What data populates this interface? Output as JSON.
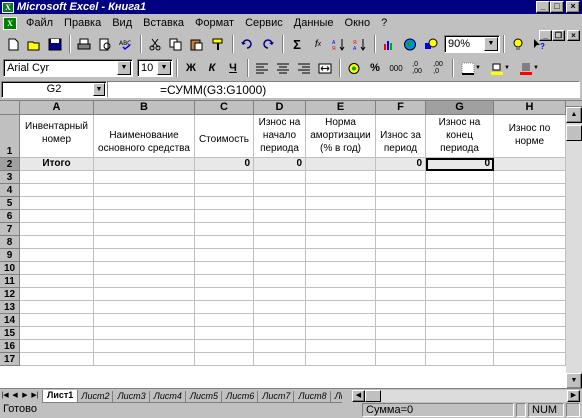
{
  "window": {
    "title": "Microsoft Excel - Книга1",
    "app_icon": "excel-icon"
  },
  "menu": [
    {
      "label": "Файл"
    },
    {
      "label": "Правка"
    },
    {
      "label": "Вид"
    },
    {
      "label": "Вставка"
    },
    {
      "label": "Формат"
    },
    {
      "label": "Сервис"
    },
    {
      "label": "Данные"
    },
    {
      "label": "Окно"
    },
    {
      "label": "?"
    }
  ],
  "standard_toolbar": {
    "zoom": "90%",
    "icons": [
      "new-icon",
      "open-icon",
      "save-icon",
      "print-icon",
      "print-preview-icon",
      "spelling-icon",
      "cut-icon",
      "copy-icon",
      "paste-icon",
      "format-painter-icon",
      "undo-icon",
      "redo-icon",
      "autosum-icon",
      "function-wizard-icon",
      "sort-ascending-icon",
      "sort-descending-icon",
      "chart-wizard-icon",
      "map-icon",
      "drawing-icon",
      "tipwizard-icon",
      "help-icon"
    ]
  },
  "formatting_toolbar": {
    "font": "Arial Cyr",
    "size": "10",
    "bold": "Ж",
    "italic": "К",
    "underline": "Ч",
    "percent": "%",
    "icons": [
      "align-left-icon",
      "align-center-icon",
      "align-right-icon",
      "merge-center-icon",
      "currency-icon",
      "percent-icon",
      "comma-icon",
      "increase-decimal-icon",
      "decrease-decimal-icon",
      "borders-icon",
      "fill-color-icon",
      "font-color-icon"
    ]
  },
  "formula_bar": {
    "name_box": "G2",
    "formula": "=СУММ(G3:G1000)"
  },
  "sheet": {
    "columns": [
      {
        "id": "A",
        "label": "A"
      },
      {
        "id": "B",
        "label": "B"
      },
      {
        "id": "C",
        "label": "C"
      },
      {
        "id": "D",
        "label": "D"
      },
      {
        "id": "E",
        "label": "E"
      },
      {
        "id": "F",
        "label": "F"
      },
      {
        "id": "G",
        "label": "G"
      },
      {
        "id": "H",
        "label": "H"
      }
    ],
    "header_row": {
      "A": "Инвентарный номер",
      "B": "Наименование основного средства",
      "C": "Стоимость",
      "D": "Износ на начало периода",
      "E": "Норма амортизации (% в год)",
      "F": "Износ за период",
      "G": "Износ на конец периода",
      "H": "Износ по норме"
    },
    "total_row": {
      "A": "Итого",
      "B": "",
      "C": "0",
      "D": "0",
      "E": "",
      "F": "0",
      "G": "0",
      "H": ""
    },
    "row_numbers": [
      "1",
      "2",
      "3",
      "4",
      "5",
      "6",
      "7",
      "8",
      "9",
      "10",
      "11",
      "12",
      "13",
      "14",
      "15",
      "16",
      "17"
    ],
    "active_cell": "G2"
  },
  "sheet_tabs": [
    "Лист1",
    "Лист2",
    "Лист3",
    "Лист4",
    "Лист5",
    "Лист6",
    "Лист7",
    "Лист8",
    "Лис"
  ],
  "status_bar": {
    "ready": "Готово",
    "sum": "Сумма=0",
    "num": "NUM"
  }
}
